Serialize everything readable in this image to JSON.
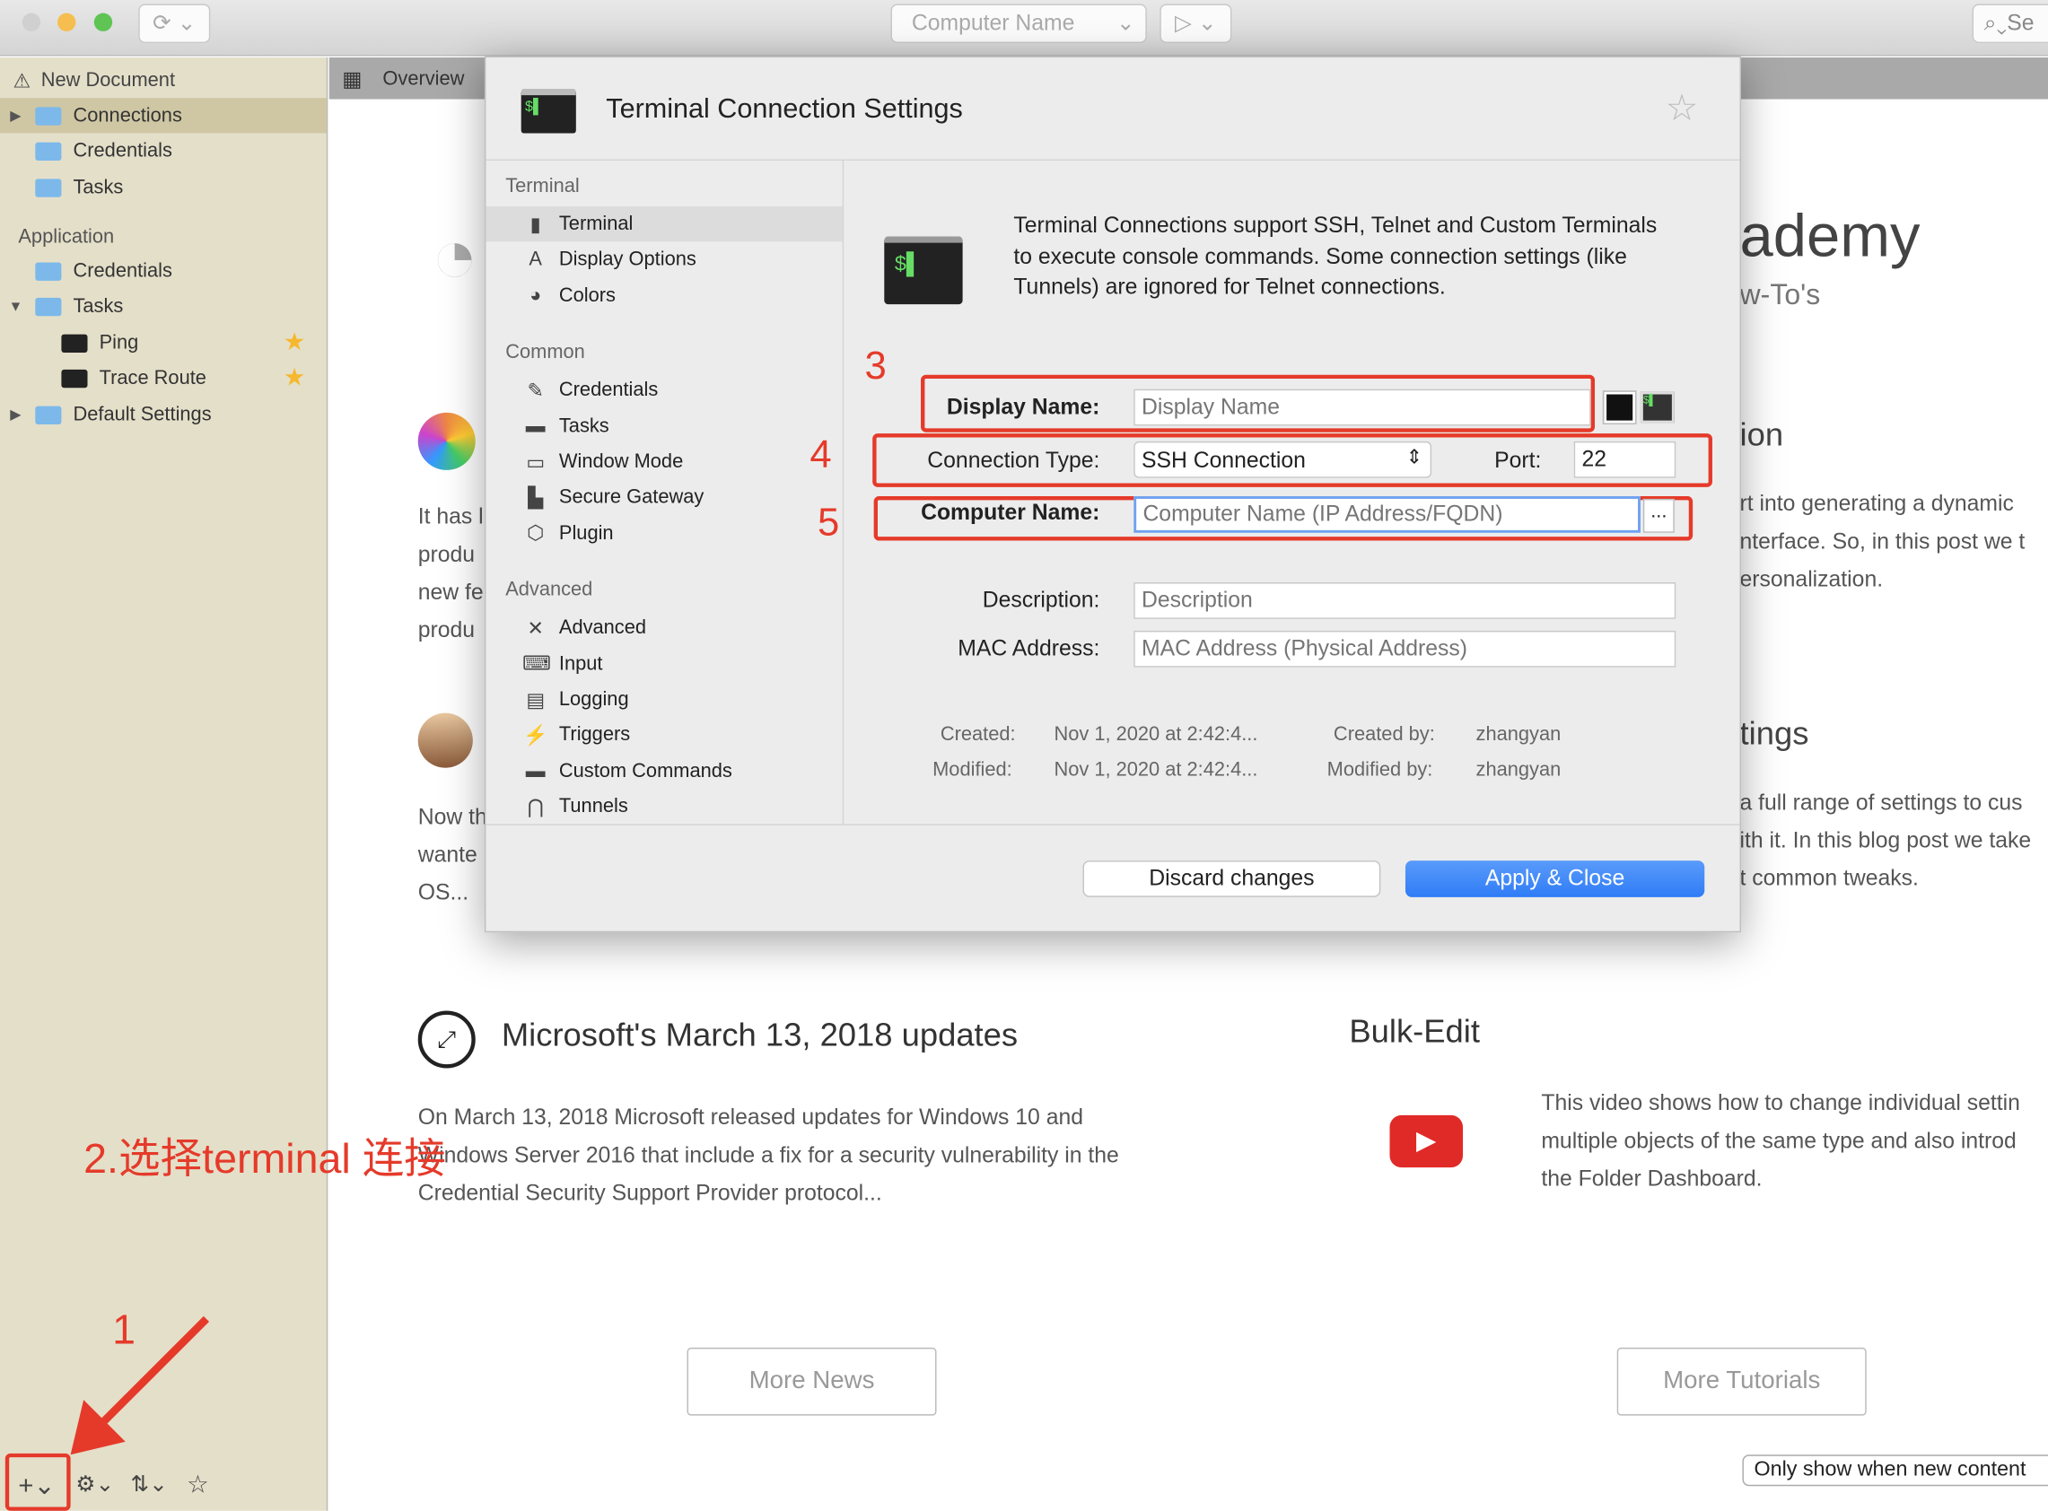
{
  "toolbar": {
    "computer_name_placeholder": "Computer Name",
    "search_label": "Se"
  },
  "sidebar": {
    "document": "New Document",
    "doc_items": [
      {
        "label": "Connections"
      },
      {
        "label": "Credentials"
      },
      {
        "label": "Tasks"
      }
    ],
    "application_header": "Application",
    "app_items": [
      {
        "label": "Credentials"
      },
      {
        "label": "Tasks"
      },
      {
        "label": "Ping"
      },
      {
        "label": "Trace Route"
      },
      {
        "label": "Default Settings"
      }
    ]
  },
  "tab": {
    "label": "Overview"
  },
  "background": {
    "academy": "ademy",
    "howtos": "w-To's",
    "ion": "ion",
    "right_text1": [
      "rt into generating a dynamic",
      "nterface. So, in this post we t",
      "ersonalization."
    ],
    "left_text1": [
      "It has l",
      "produ",
      "new fe",
      "produ"
    ],
    "settings_heading": "tings",
    "right_text2": [
      "a full range of settings to cus",
      "ith it. In this blog post we take",
      "t common tweaks."
    ],
    "left_text2": [
      "Now th",
      "wante",
      "OS..."
    ],
    "news_title": "Microsoft's March 13, 2018 updates",
    "news_text": [
      "On March 13, 2018 Microsoft released updates for Windows 10 and",
      "Windows Server 2016 that include a fix for a security vulnerability in the",
      "Credential Security Support Provider protocol..."
    ],
    "bulk_title": "Bulk-Edit",
    "bulk_text": [
      "This video shows how to change individual settin",
      "multiple objects of the same type and also introd",
      "the Folder Dashboard."
    ],
    "more_news": "More News",
    "more_tutorials": "More Tutorials",
    "only_show": "Only show when new content"
  },
  "annotations": {
    "step1": "1",
    "step2": "2.选择terminal 连接",
    "step3": "3",
    "step4": "4",
    "step5": "5",
    "color": "#e53a2a"
  },
  "modal": {
    "title": "Terminal Connection Settings",
    "nav": [
      {
        "section": "Terminal",
        "items": [
          "Terminal",
          "Display Options",
          "Colors"
        ]
      },
      {
        "section": "Common",
        "items": [
          "Credentials",
          "Tasks",
          "Window Mode",
          "Secure Gateway",
          "Plugin"
        ]
      },
      {
        "section": "Advanced",
        "items": [
          "Advanced",
          "Input",
          "Logging",
          "Triggers",
          "Custom Commands",
          "Tunnels"
        ]
      }
    ],
    "description": "Terminal Connections support SSH, Telnet and Custom Terminals to execute console commands. Some connection settings (like Tunnels) are ignored for Telnet connections.",
    "display_name_label": "Display Name:",
    "display_name_placeholder": "Display Name",
    "connection_type_label": "Connection Type:",
    "connection_type_value": "SSH Connection",
    "port_label": "Port:",
    "port_value": "22",
    "computer_name_label": "Computer Name:",
    "computer_name_placeholder": "Computer Name (IP Address/FQDN)",
    "browse": "...",
    "description_label": "Description:",
    "description_placeholder": "Description",
    "mac_label": "MAC Address:",
    "mac_placeholder": "MAC Address (Physical Address)",
    "created_label": "Created:",
    "created_value": "Nov 1, 2020 at 2:42:4...",
    "created_by_label": "Created by:",
    "created_by_value": "zhangyan",
    "modified_label": "Modified:",
    "modified_value": "Nov 1, 2020 at 2:42:4...",
    "modified_by_label": "Modified by:",
    "modified_by_value": "zhangyan",
    "discard": "Discard changes",
    "apply": "Apply & Close",
    "accent": "#2f7cf6"
  }
}
